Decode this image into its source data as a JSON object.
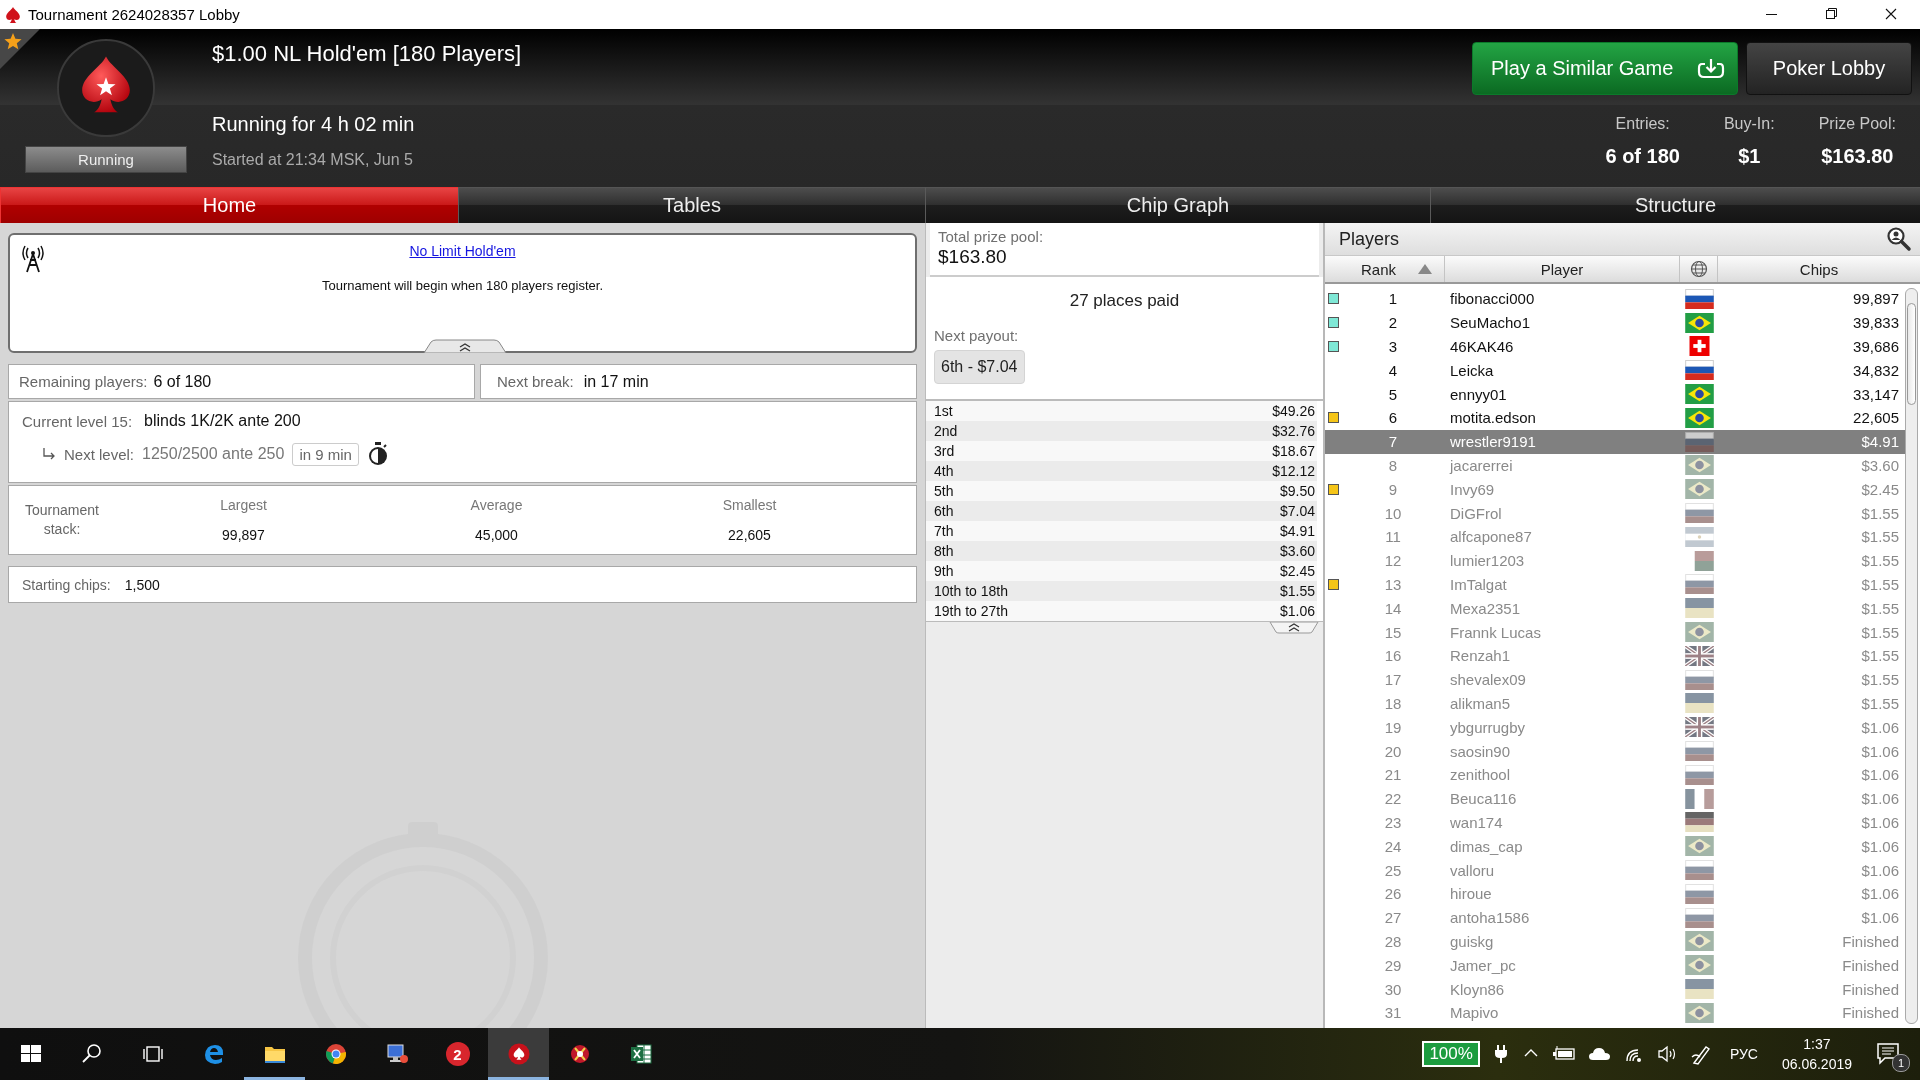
{
  "window": {
    "title": "Tournament 2624028357 Lobby"
  },
  "header": {
    "status": "Running",
    "title": "$1.00 NL Hold'em [180 Players]",
    "running_for": "Running for 4 h 02 min",
    "started": "Started at 21:34 MSK, Jun 5",
    "buttons": [
      {
        "label": "Play a Similar Game",
        "kind": "primary"
      },
      {
        "label": "Poker Lobby",
        "kind": "secondary"
      }
    ],
    "stats": [
      {
        "label": "Entries:",
        "value": "6 of 180"
      },
      {
        "label": "Buy-In:",
        "value": "$1"
      },
      {
        "label": "Prize Pool:",
        "value": "$163.80"
      }
    ]
  },
  "tabs": [
    {
      "label": "Home",
      "selected": true
    },
    {
      "label": "Tables",
      "selected": false
    },
    {
      "label": "Chip Graph",
      "selected": false
    },
    {
      "label": "Structure",
      "selected": false
    }
  ],
  "info": {
    "link": "No Limit Hold'em",
    "message": "Tournament will begin when 180 players register."
  },
  "remaining": {
    "label": "Remaining players:",
    "value": "6 of 180"
  },
  "next_break": {
    "label": "Next break:",
    "value": "in 17 min"
  },
  "level": {
    "label": "Current level 15:",
    "value": "blinds 1K/2K ante 200",
    "next_label": "Next level:",
    "next_value": "1250/2500 ante 250",
    "next_in": "in 9 min"
  },
  "stack": {
    "label": "Tournament stack:",
    "columns": [
      {
        "label": "Largest",
        "value": "99,897"
      },
      {
        "label": "Average",
        "value": "45,000"
      },
      {
        "label": "Smallest",
        "value": "22,605"
      }
    ]
  },
  "starting_chips": {
    "label": "Starting chips:",
    "value": "1,500"
  },
  "prizes": {
    "total_label": "Total prize pool:",
    "total": "$163.80",
    "places_paid": "27 places paid",
    "next_payout_label": "Next payout:",
    "next_payout": "6th - $7.04",
    "payouts": [
      {
        "place": "1st",
        "amount": "$49.26"
      },
      {
        "place": "2nd",
        "amount": "$32.76"
      },
      {
        "place": "3rd",
        "amount": "$18.67"
      },
      {
        "place": "4th",
        "amount": "$12.12"
      },
      {
        "place": "5th",
        "amount": "$9.50"
      },
      {
        "place": "6th",
        "amount": "$7.04"
      },
      {
        "place": "7th",
        "amount": "$4.91"
      },
      {
        "place": "8th",
        "amount": "$3.60"
      },
      {
        "place": "9th",
        "amount": "$2.45"
      },
      {
        "place": "10th to 18th",
        "amount": "$1.55"
      },
      {
        "place": "19th to 27th",
        "amount": "$1.06"
      }
    ]
  },
  "players": {
    "title": "Players",
    "columns": [
      {
        "label": "Rank",
        "sorted": true
      },
      {
        "label": "Player",
        "sorted": false
      },
      {
        "label": "Chips",
        "sorted": false
      }
    ],
    "rows": [
      {
        "rank": "1",
        "name": "fibonacci000",
        "kind": "ru",
        "chips": "99,897",
        "color": "#7fe8d6",
        "selected": false,
        "eliminated": false
      },
      {
        "rank": "2",
        "name": "SeuMacho1",
        "kind": "br",
        "chips": "39,833",
        "color": "#7fe8d6",
        "selected": false,
        "eliminated": false
      },
      {
        "rank": "3",
        "name": "46KAK46",
        "kind": "ch",
        "chips": "39,686",
        "color": "#7fe8d6",
        "selected": false,
        "eliminated": false
      },
      {
        "rank": "4",
        "name": "Leicka",
        "kind": "ru",
        "chips": "34,832",
        "selected": false,
        "eliminated": false
      },
      {
        "rank": "5",
        "name": "ennyy01",
        "kind": "br",
        "chips": "33,147",
        "selected": false,
        "eliminated": false
      },
      {
        "rank": "6",
        "name": "motita.edson",
        "kind": "br",
        "chips": "22,605",
        "color": "#f5c518",
        "selected": false,
        "eliminated": false
      },
      {
        "rank": "7",
        "name": "wrestler9191",
        "kind": "ru",
        "chips": "$4.91",
        "selected": true,
        "eliminated": true
      },
      {
        "rank": "8",
        "name": "jacarerrei",
        "kind": "br",
        "chips": "$3.60",
        "selected": false,
        "eliminated": true
      },
      {
        "rank": "9",
        "name": "Invy69",
        "kind": "br",
        "chips": "$2.45",
        "color": "#f5c518",
        "selected": false,
        "eliminated": true
      },
      {
        "rank": "10",
        "name": "DiGFrol",
        "kind": "ru",
        "chips": "$1.55",
        "selected": false,
        "eliminated": true
      },
      {
        "rank": "11",
        "name": "alfcapone87",
        "kind": "ar",
        "chips": "$1.55",
        "selected": false,
        "eliminated": true
      },
      {
        "rank": "12",
        "name": "lumier1203",
        "kind": "mg",
        "chips": "$1.55",
        "selected": false,
        "eliminated": true
      },
      {
        "rank": "13",
        "name": "ImTalgat",
        "kind": "ru",
        "chips": "$1.55",
        "color": "#f5c518",
        "selected": false,
        "eliminated": true
      },
      {
        "rank": "14",
        "name": "Mexa2351",
        "kind": "ua",
        "chips": "$1.55",
        "selected": false,
        "eliminated": true
      },
      {
        "rank": "15",
        "name": "Frannk Lucas",
        "kind": "br",
        "chips": "$1.55",
        "selected": false,
        "eliminated": true
      },
      {
        "rank": "16",
        "name": "Renzah1",
        "kind": "gb",
        "chips": "$1.55",
        "selected": false,
        "eliminated": true
      },
      {
        "rank": "17",
        "name": "shevalex09",
        "kind": "ru",
        "chips": "$1.55",
        "selected": false,
        "eliminated": true
      },
      {
        "rank": "18",
        "name": "alikman5",
        "kind": "ua",
        "chips": "$1.55",
        "selected": false,
        "eliminated": true
      },
      {
        "rank": "19",
        "name": "ybgurrugby",
        "kind": "gb",
        "chips": "$1.06",
        "selected": false,
        "eliminated": true
      },
      {
        "rank": "20",
        "name": "saosin90",
        "kind": "ru",
        "chips": "$1.06",
        "selected": false,
        "eliminated": true
      },
      {
        "rank": "21",
        "name": "zenithool",
        "kind": "ru",
        "chips": "$1.06",
        "selected": false,
        "eliminated": true
      },
      {
        "rank": "22",
        "name": "Beuca116",
        "kind": "fr",
        "chips": "$1.06",
        "selected": false,
        "eliminated": true
      },
      {
        "rank": "23",
        "name": "wan174",
        "kind": "de",
        "chips": "$1.06",
        "selected": false,
        "eliminated": true
      },
      {
        "rank": "24",
        "name": "dimas_cap",
        "kind": "br",
        "chips": "$1.06",
        "selected": false,
        "eliminated": true
      },
      {
        "rank": "25",
        "name": "valloru",
        "kind": "ru",
        "chips": "$1.06",
        "selected": false,
        "eliminated": true
      },
      {
        "rank": "26",
        "name": "hiroue",
        "kind": "ru",
        "chips": "$1.06",
        "selected": false,
        "eliminated": true
      },
      {
        "rank": "27",
        "name": "antoha1586",
        "kind": "ru",
        "chips": "$1.06",
        "selected": false,
        "eliminated": true
      },
      {
        "rank": "28",
        "name": "guiskg",
        "kind": "br",
        "chips": "Finished",
        "selected": false,
        "eliminated": true
      },
      {
        "rank": "29",
        "name": "Jamer_pc",
        "kind": "br",
        "chips": "Finished",
        "selected": false,
        "eliminated": true
      },
      {
        "rank": "30",
        "name": "Kloyn86",
        "kind": "ua",
        "chips": "Finished",
        "selected": false,
        "eliminated": true
      },
      {
        "rank": "31",
        "name": "Mapivo",
        "kind": "br",
        "chips": "Finished",
        "selected": false,
        "eliminated": true
      }
    ]
  },
  "taskbar": {
    "apps": [
      {
        "kind": "start",
        "active": false,
        "open": false
      },
      {
        "kind": "search",
        "active": false,
        "open": false
      },
      {
        "kind": "taskview",
        "active": false,
        "open": false
      },
      {
        "kind": "edge",
        "active": false,
        "open": false
      },
      {
        "kind": "folder",
        "active": false,
        "open": true
      },
      {
        "kind": "chrome",
        "active": false,
        "open": false
      },
      {
        "kind": "computer",
        "active": false,
        "open": false
      },
      {
        "kind": "numbered",
        "label": "2",
        "active": false,
        "open": false
      },
      {
        "kind": "spade",
        "active": true,
        "open": true
      },
      {
        "kind": "redapp",
        "active": false,
        "open": false
      },
      {
        "kind": "sheet",
        "active": false,
        "open": false
      }
    ],
    "battery": "100%",
    "language": "РУС",
    "time": "1:37",
    "date": "06.06.2019",
    "notifications": "1"
  }
}
